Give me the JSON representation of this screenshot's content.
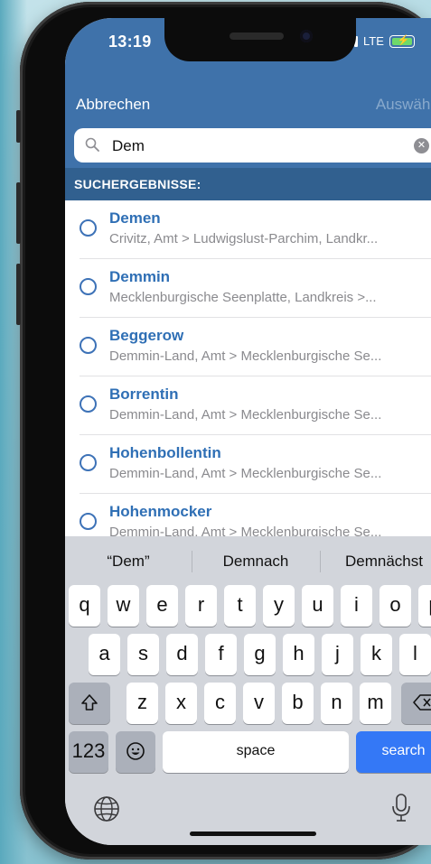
{
  "status": {
    "time": "13:19",
    "network": "LTE"
  },
  "nav": {
    "cancel": "Abbrechen",
    "select": "Auswählen"
  },
  "search": {
    "value": "Dem"
  },
  "section_header": "SUCHERGEBNISSE:",
  "results": [
    {
      "title": "Demen",
      "subtitle": "Crivitz, Amt > Ludwigslust-Parchim, Landkr..."
    },
    {
      "title": "Demmin",
      "subtitle": "Mecklenburgische Seenplatte, Landkreis >..."
    },
    {
      "title": "Beggerow",
      "subtitle": "Demmin-Land, Amt > Mecklenburgische Se..."
    },
    {
      "title": "Borrentin",
      "subtitle": "Demmin-Land, Amt > Mecklenburgische Se..."
    },
    {
      "title": "Hohenbollentin",
      "subtitle": "Demmin-Land, Amt > Mecklenburgische Se..."
    },
    {
      "title": "Hohenmocker",
      "subtitle": "Demmin-Land, Amt > Mecklenburgische Se..."
    }
  ],
  "keyboard": {
    "suggestions": [
      "“Dem”",
      "Demnach",
      "Demnächst"
    ],
    "row1": [
      "q",
      "w",
      "e",
      "r",
      "t",
      "y",
      "u",
      "i",
      "o",
      "p"
    ],
    "row2": [
      "a",
      "s",
      "d",
      "f",
      "g",
      "h",
      "j",
      "k",
      "l"
    ],
    "row3": [
      "z",
      "x",
      "c",
      "v",
      "b",
      "n",
      "m"
    ],
    "numbers_key": "123",
    "space_key": "space",
    "search_key": "search"
  },
  "colors": {
    "accent": "#3f72aa",
    "section": "#31608f",
    "link": "#2f6fb5",
    "search_key": "#3478f6"
  }
}
